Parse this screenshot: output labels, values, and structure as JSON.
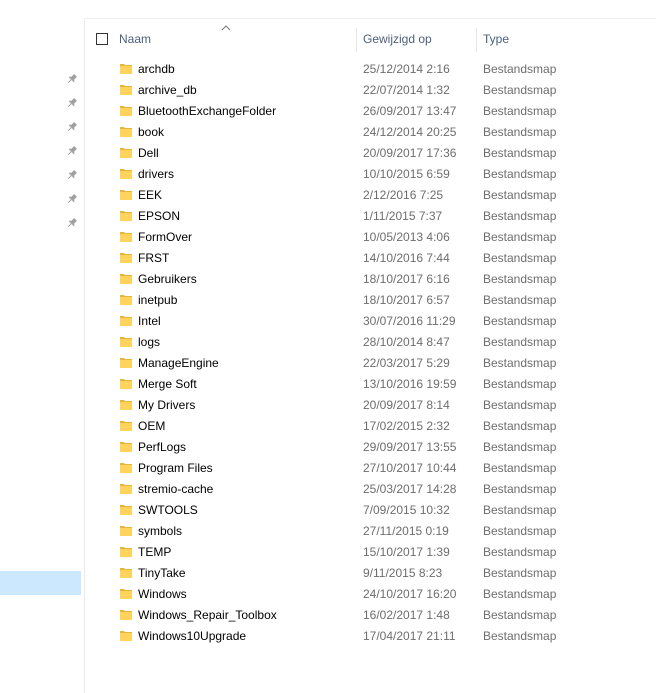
{
  "header": {
    "name_label": "Naam",
    "date_label": "Gewijzigd op",
    "type_label": "Type"
  },
  "colors": {
    "folder_yellow": "#ffd35c",
    "folder_shade": "#e8b53a",
    "selection": "#cce8ff",
    "header_text": "#4c607a"
  },
  "nav": {
    "pinned_count": 7,
    "pin_icon": "pin-icon"
  },
  "files": [
    {
      "name": "archdb",
      "date": "25/12/2014 2:16",
      "type": "Bestandsmap"
    },
    {
      "name": "archive_db",
      "date": "22/07/2014 1:32",
      "type": "Bestandsmap"
    },
    {
      "name": "BluetoothExchangeFolder",
      "date": "26/09/2017 13:47",
      "type": "Bestandsmap"
    },
    {
      "name": "book",
      "date": "24/12/2014 20:25",
      "type": "Bestandsmap"
    },
    {
      "name": "Dell",
      "date": "20/09/2017 17:36",
      "type": "Bestandsmap"
    },
    {
      "name": "drivers",
      "date": "10/10/2015 6:59",
      "type": "Bestandsmap"
    },
    {
      "name": "EEK",
      "date": "2/12/2016 7:25",
      "type": "Bestandsmap"
    },
    {
      "name": "EPSON",
      "date": "1/11/2015 7:37",
      "type": "Bestandsmap"
    },
    {
      "name": "FormOver",
      "date": "10/05/2013 4:06",
      "type": "Bestandsmap"
    },
    {
      "name": "FRST",
      "date": "14/10/2016 7:44",
      "type": "Bestandsmap"
    },
    {
      "name": "Gebruikers",
      "date": "18/10/2017 6:16",
      "type": "Bestandsmap"
    },
    {
      "name": "inetpub",
      "date": "18/10/2017 6:57",
      "type": "Bestandsmap"
    },
    {
      "name": "Intel",
      "date": "30/07/2016 11:29",
      "type": "Bestandsmap"
    },
    {
      "name": "logs",
      "date": "28/10/2014 8:47",
      "type": "Bestandsmap"
    },
    {
      "name": "ManageEngine",
      "date": "22/03/2017 5:29",
      "type": "Bestandsmap"
    },
    {
      "name": "Merge Soft",
      "date": "13/10/2016 19:59",
      "type": "Bestandsmap"
    },
    {
      "name": "My Drivers",
      "date": "20/09/2017 8:14",
      "type": "Bestandsmap"
    },
    {
      "name": "OEM",
      "date": "17/02/2015 2:32",
      "type": "Bestandsmap"
    },
    {
      "name": "PerfLogs",
      "date": "29/09/2017 13:55",
      "type": "Bestandsmap"
    },
    {
      "name": "Program Files",
      "date": "27/10/2017 10:44",
      "type": "Bestandsmap"
    },
    {
      "name": "stremio-cache",
      "date": "25/03/2017 14:28",
      "type": "Bestandsmap"
    },
    {
      "name": "SWTOOLS",
      "date": "7/09/2015 10:32",
      "type": "Bestandsmap"
    },
    {
      "name": "symbols",
      "date": "27/11/2015 0:19",
      "type": "Bestandsmap"
    },
    {
      "name": "TEMP",
      "date": "15/10/2017 1:39",
      "type": "Bestandsmap"
    },
    {
      "name": "TinyTake",
      "date": "9/11/2015 8:23",
      "type": "Bestandsmap"
    },
    {
      "name": "Windows",
      "date": "24/10/2017 16:20",
      "type": "Bestandsmap"
    },
    {
      "name": "Windows_Repair_Toolbox",
      "date": "16/02/2017 1:48",
      "type": "Bestandsmap"
    },
    {
      "name": "Windows10Upgrade",
      "date": "17/04/2017 21:11",
      "type": "Bestandsmap"
    }
  ]
}
